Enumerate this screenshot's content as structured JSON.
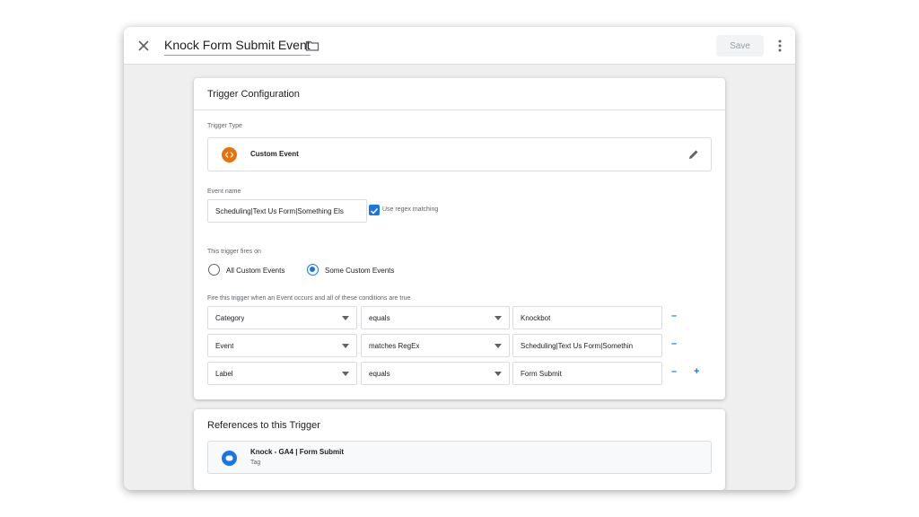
{
  "header": {
    "title": "Knock Form Submit Event",
    "save_label": "Save"
  },
  "config": {
    "title": "Trigger Configuration",
    "trigger_type_label": "Trigger Type",
    "trigger_type_value": "Custom Event",
    "event_name_label": "Event name",
    "event_name_value": "Scheduling|Text Us Form|Something Els",
    "regex_label": "Use regex matching",
    "fires_on_label": "This trigger fires on",
    "option_all": "All Custom Events",
    "option_some": "Some Custom Events",
    "conditions_label": "Fire this trigger when an Event occurs and all of these conditions are true",
    "conditions": [
      {
        "variable": "Category",
        "operator": "equals",
        "value": "Knockbot"
      },
      {
        "variable": "Event",
        "operator": "matches RegEx",
        "value": "Scheduling|Text Us Form|Somethin"
      },
      {
        "variable": "Label",
        "operator": "equals",
        "value": "Form Submit"
      }
    ],
    "minus_sign": "–",
    "plus_sign": "+"
  },
  "references": {
    "title": "References to this Trigger",
    "items": [
      {
        "name": "Knock - GA4 | Form Submit",
        "type": "Tag"
      }
    ]
  },
  "colors": {
    "accent": "#1a73e8",
    "custom_event_icon": "#e8710a"
  }
}
